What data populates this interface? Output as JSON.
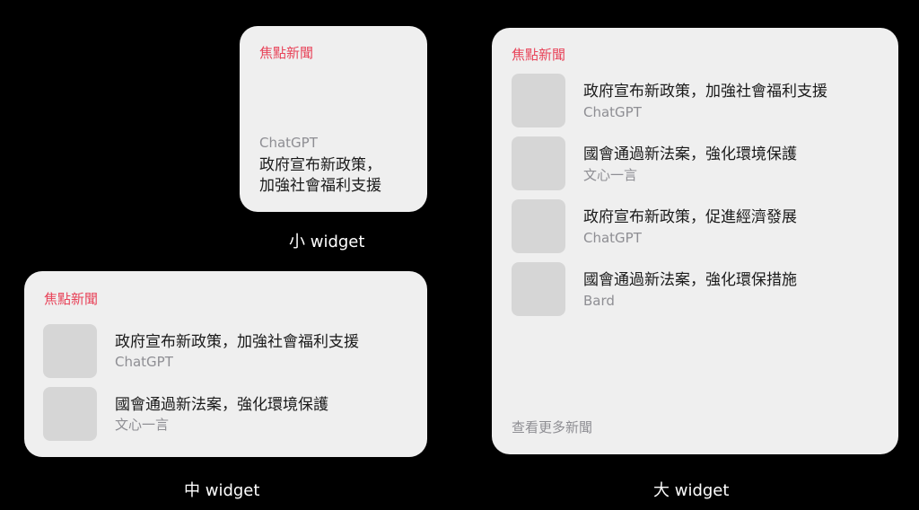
{
  "small_widget": {
    "title": "焦點新聞",
    "source": "ChatGPT",
    "headline_line1": "政府宣布新政策，",
    "headline_line2": "加強社會福利支援",
    "caption": "小 widget"
  },
  "medium_widget": {
    "title": "焦點新聞",
    "items": [
      {
        "headline": "政府宣布新政策，加強社會福利支援",
        "source": "ChatGPT"
      },
      {
        "headline": "國會通過新法案，強化環境保護",
        "source": "文心一言"
      }
    ],
    "caption": "中 widget"
  },
  "large_widget": {
    "title": "焦點新聞",
    "items": [
      {
        "headline": "政府宣布新政策，加強社會福利支援",
        "source": "ChatGPT"
      },
      {
        "headline": "國會通過新法案，強化環境保護",
        "source": "文心一言"
      },
      {
        "headline": "政府宣布新政策，促進經濟發展",
        "source": "ChatGPT"
      },
      {
        "headline": "國會通過新法案，強化環保措施",
        "source": "Bard"
      }
    ],
    "more_label": "查看更多新聞",
    "caption": "大 widget"
  },
  "colors": {
    "background": "#000000",
    "widget_background": "#efefef",
    "accent": "#e8445a",
    "thumbnail": "#d6d6d6",
    "secondary_text": "#8e8e93"
  }
}
